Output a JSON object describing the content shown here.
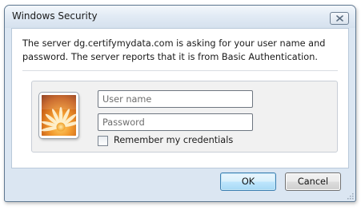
{
  "window": {
    "title": "Windows Security"
  },
  "message": "The server dg.certifymydata.com is asking for your user name and password. The server reports that it is from Basic Authentication.",
  "credentials": {
    "username": {
      "placeholder": "User name",
      "value": ""
    },
    "password": {
      "placeholder": "Password",
      "value": ""
    },
    "remember": {
      "label": "Remember my credentials",
      "checked": false
    }
  },
  "buttons": {
    "ok": "OK",
    "cancel": "Cancel"
  },
  "icons": {
    "avatar": "user-tile-flower-icon",
    "close": "close-icon",
    "resize": "resize-grip-icon"
  },
  "colors": {
    "window_frame": "#dbe6f2",
    "ok_button_accent": "#3c7fb1",
    "content_background": "#ffffff"
  }
}
